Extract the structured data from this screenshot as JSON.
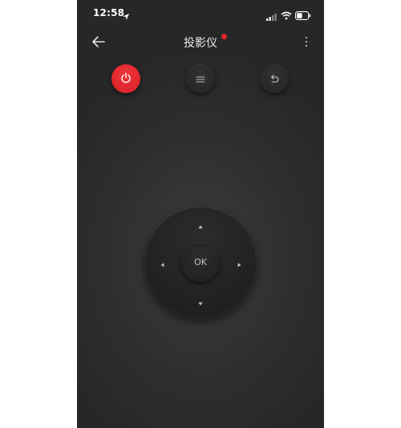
{
  "status_bar": {
    "time": "12:58",
    "icons": [
      "location-arrow-icon",
      "signal-icon",
      "wifi-icon",
      "battery-icon"
    ]
  },
  "header": {
    "back_icon": "back-arrow-icon",
    "title": "投影仪",
    "more_icon": "more-vertical-icon",
    "indicator_color": "#e8232a"
  },
  "controls": {
    "buttons": [
      {
        "name": "power",
        "icon": "power-icon",
        "color": "#e0262c"
      },
      {
        "name": "menu",
        "icon": "menu-icon"
      },
      {
        "name": "return",
        "icon": "return-icon"
      }
    ]
  },
  "dpad": {
    "ok_label": "OK",
    "arrows": [
      "up",
      "down",
      "left",
      "right"
    ]
  },
  "colors": {
    "background": "#2e2f31",
    "accent_red": "#e8232a",
    "text": "#e9e9e9"
  }
}
